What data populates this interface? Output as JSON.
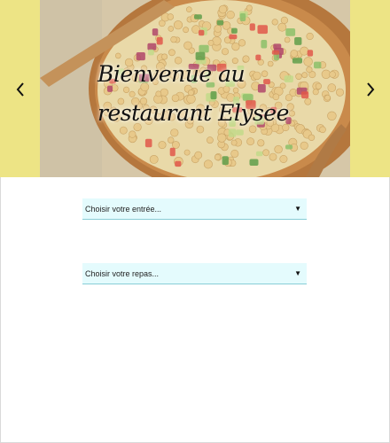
{
  "hero": {
    "title_line1": "Bienvenue au",
    "title_line2": "restaurant Elysee",
    "background_color": "#ede485",
    "image": "chickpea-salad-bowl"
  },
  "nav": {
    "prev_icon": "chevron-left-icon",
    "next_icon": "chevron-right-icon"
  },
  "form": {
    "entree_select": {
      "selected": "Choisir votre entrée..."
    },
    "repas_select": {
      "selected": "Choisir votre repas..."
    }
  },
  "colors": {
    "select_bg": "#e4fbfd",
    "select_border": "#88cdd6"
  }
}
